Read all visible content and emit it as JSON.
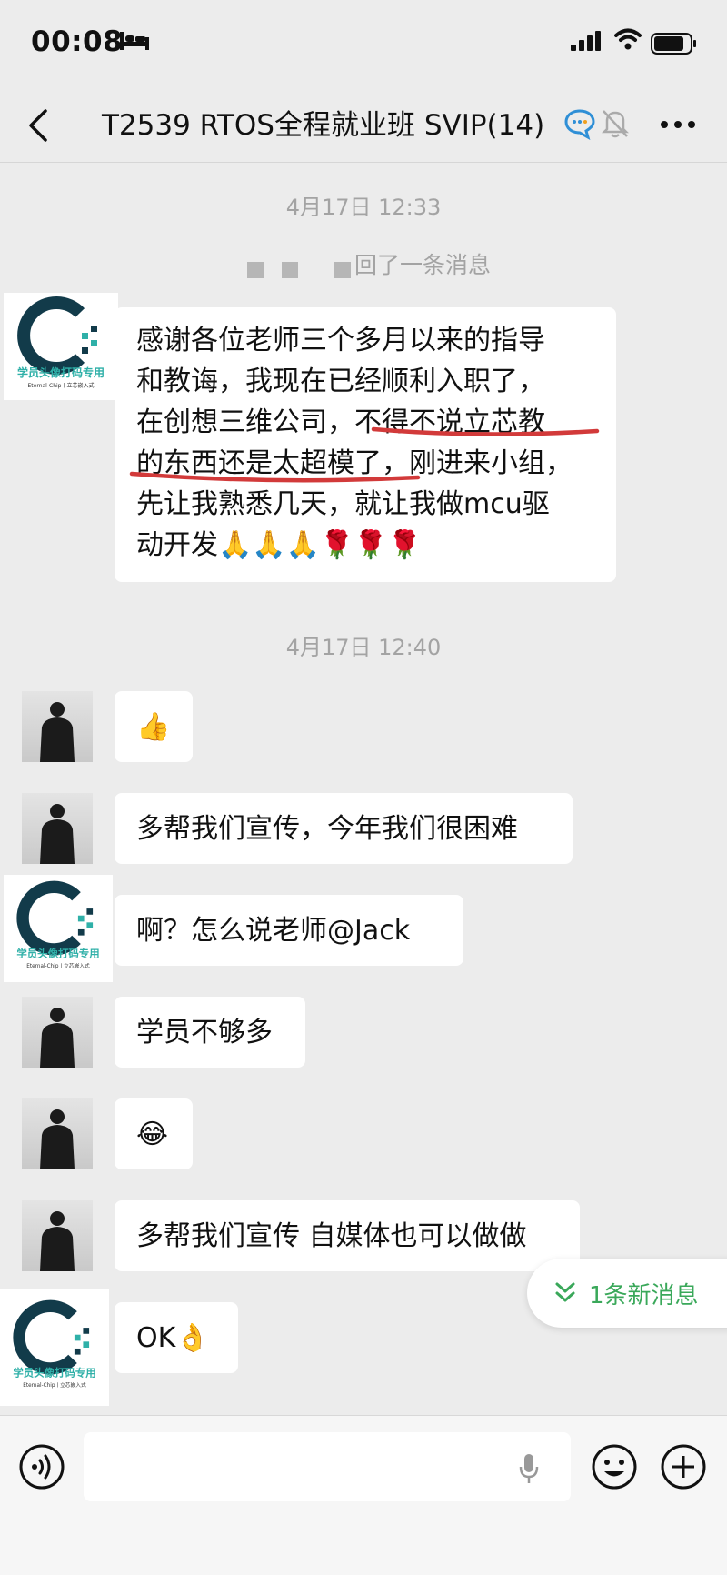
{
  "status": {
    "time": "00:08"
  },
  "header": {
    "title": "T2539 RTOS全程就业班 SVIP(14)"
  },
  "timestamps": [
    "4月17日 12:33",
    "4月17日 12:40"
  ],
  "recall_notice": "回了一条消息",
  "avatar_logo": {
    "line1": "学员头像打码专用",
    "line2": "Eternal-Chip丨立芯嵌入式"
  },
  "messages": {
    "long": {
      "lines": [
        "感谢各位老师三个多月以来的指导",
        "和教诲，我现在已经顺利入职了，",
        "在创想三维公司，不得不说立芯教",
        "的东西还是太超模了，刚进来小组，",
        "先让我熟悉几天，就让我做mcu驱",
        "动开发🙏🙏🙏🌹🌹🌹"
      ]
    },
    "m1": "👍",
    "m2": "多帮我们宣传，今年我们很困难",
    "m3": "啊？怎么说老师@Jack",
    "m4": "学员不够多",
    "m5": "😂",
    "m6": "多帮我们宣传 自媒体也可以做做",
    "m7": "OK👌"
  },
  "new_messages": "1条新消息",
  "colors": {
    "accent_green": "#3aa85a",
    "underline_red": "#d23a3a",
    "logo_teal": "#123b4a"
  }
}
